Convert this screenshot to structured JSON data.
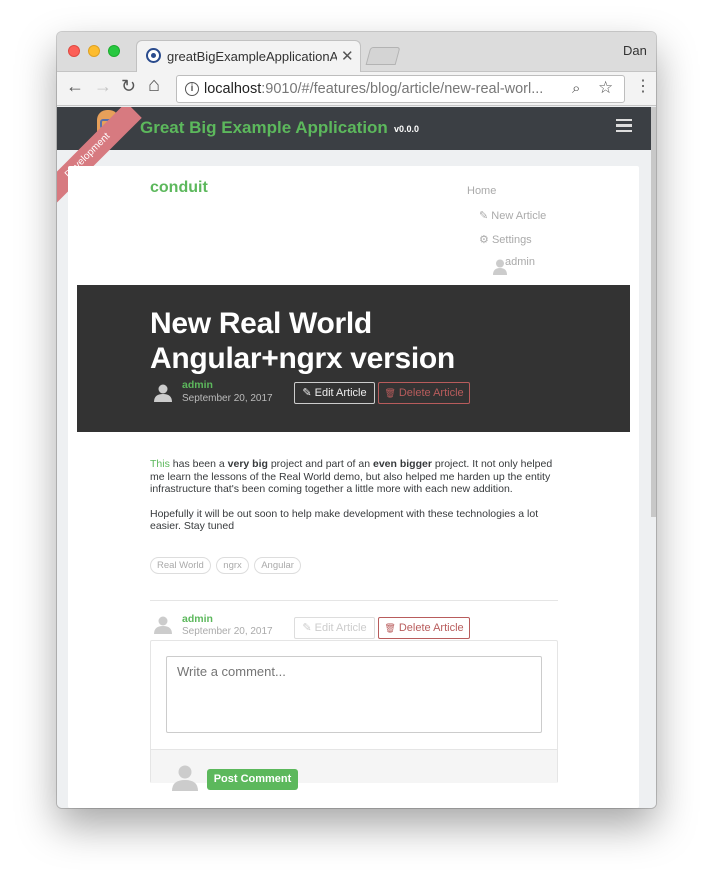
{
  "browser": {
    "tab_title": "greatBigExampleApplicationAp",
    "tab_close": "✕",
    "profile_name": "Dan",
    "url_host": "localhost",
    "url_rest": ":9010/#/features/blog/article/new-real-worl...",
    "back_glyph": "←",
    "forward_glyph": "→",
    "reload_glyph": "↻",
    "home_glyph": "⌂",
    "info_glyph": "i",
    "zoom_glyph": "⌕",
    "star_glyph": "☆",
    "menu_glyph": "⋮"
  },
  "app": {
    "title": "Great Big Example Application",
    "version": "v0.0.0",
    "ribbon": "Development",
    "brand_color": "#5cb85c",
    "header_color": "#3b3f44"
  },
  "nav": {
    "brand": "conduit",
    "home": "Home",
    "new_article": "New Article",
    "settings": "Settings",
    "user": "admin",
    "edit_glyph": "✎",
    "gear_glyph": "⚙"
  },
  "article": {
    "title": "New Real World Angular+ngrx version",
    "author": "admin",
    "date": "September 20, 2017",
    "edit_label": "Edit Article",
    "delete_label": "Delete Article",
    "pencil_glyph": "✎",
    "trash_glyph": "🗑",
    "body_p1_word": "This",
    "body_p1_a": " has been a ",
    "body_p1_bold1": "very big",
    "body_p1_b": " project and part of an ",
    "body_p1_bold2": "even bigger",
    "body_p1_c": " project. It not only helped me learn the lessons of the Real World demo, but also helped me harden up the entity infrastructure that's been coming together a little more with each new addition.",
    "body_p2": "Hopefully it will be out soon to help make development with these technologies a lot easier. Stay tuned",
    "tags": [
      "Real World",
      "ngrx",
      "Angular"
    ]
  },
  "comment": {
    "placeholder": "Write a comment...",
    "post_label": "Post Comment"
  }
}
